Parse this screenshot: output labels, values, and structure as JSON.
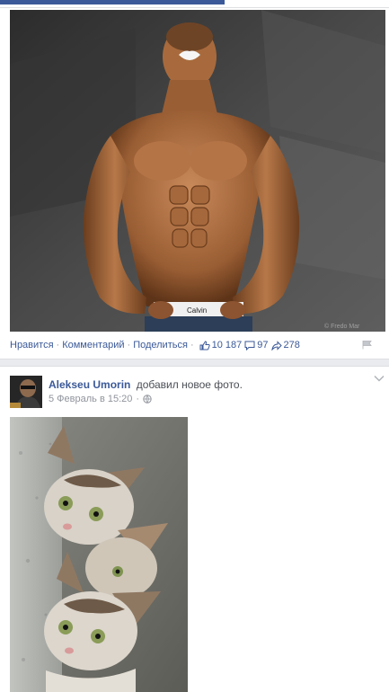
{
  "post1": {
    "actions": {
      "like": "Нравится",
      "comment": "Комментарий",
      "share": "Поделиться"
    },
    "stats": {
      "likes": "10 187",
      "comments": "97",
      "shares": "278"
    }
  },
  "post2": {
    "author": "Alekseu Umorin",
    "action": "добавил новое фото.",
    "timestamp": "5 Февраль в 15:20"
  },
  "colors": {
    "link": "#3b5998",
    "meta": "#90949c",
    "background": "#e9ebee"
  },
  "icons": {
    "like": "thumbs-up-icon",
    "comment": "comment-bubble-icon",
    "share": "share-arrow-icon",
    "flag": "flag-icon",
    "privacy": "globe-icon",
    "menu": "chevron-down-icon"
  }
}
